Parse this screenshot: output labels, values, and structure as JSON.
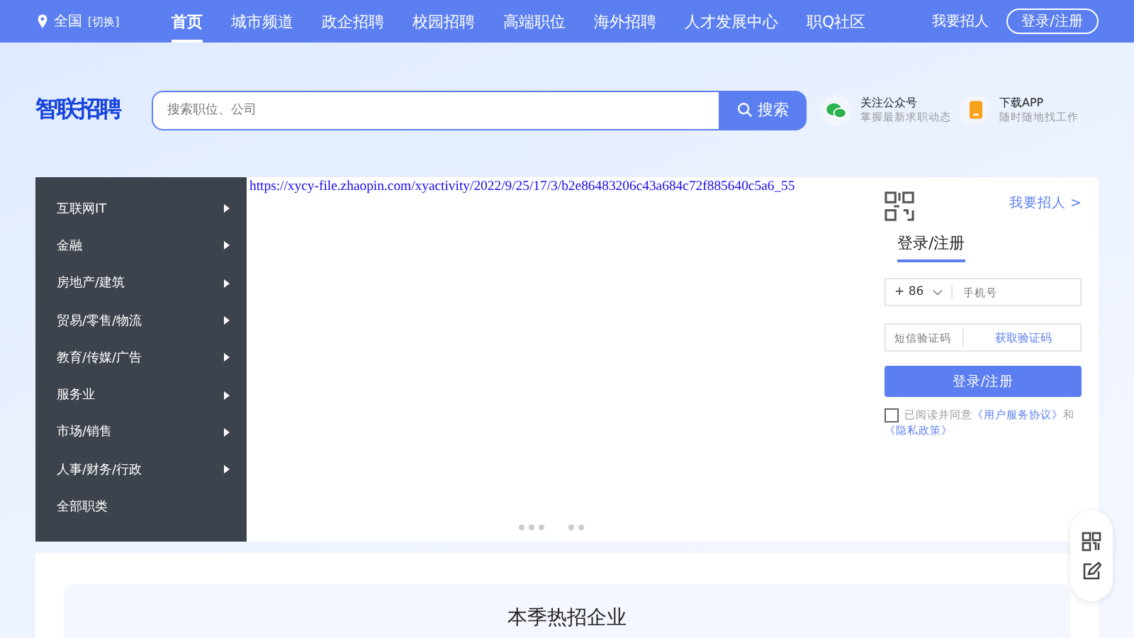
{
  "location": {
    "city": "全国",
    "switch": "[切换]"
  },
  "nav": [
    {
      "label": "首页",
      "selected": true
    },
    {
      "label": "城市频道",
      "selected": false
    },
    {
      "label": "政企招聘",
      "selected": false
    },
    {
      "label": "校园招聘",
      "selected": false
    },
    {
      "label": "高端职位",
      "selected": false
    },
    {
      "label": "海外招聘",
      "selected": false
    },
    {
      "label": "人才发展中心",
      "selected": false
    },
    {
      "label": "职Q社区",
      "selected": false
    }
  ],
  "employer_link": "我要招人",
  "login_button": "登录/注册",
  "logo": "智联招聘",
  "search": {
    "placeholder": "搜索职位、公司",
    "button": "搜索"
  },
  "promos": [
    {
      "title": "关注公众号",
      "subtitle": "掌握最新求职动态"
    },
    {
      "title": "下载APP",
      "subtitle": "随时随地找工作"
    }
  ],
  "categories": [
    {
      "label": "互联网IT",
      "has_submenu": true
    },
    {
      "label": "金融",
      "has_submenu": true
    },
    {
      "label": "房地产/建筑",
      "has_submenu": true
    },
    {
      "label": "贸易/零售/物流",
      "has_submenu": true
    },
    {
      "label": "教育/传媒/广告",
      "has_submenu": true
    },
    {
      "label": "服务业",
      "has_submenu": true
    },
    {
      "label": "市场/销售",
      "has_submenu": true
    },
    {
      "label": "人事/财务/行政",
      "has_submenu": true
    },
    {
      "label": "全部职类",
      "has_submenu": false
    }
  ],
  "banner": {
    "broken_image_url": "https://xycy-file.zhaopin.com/xyactivity/2022/9/25/17/3/b2e86483206c43a684c72f885640c5a6_55",
    "dot_groups": [
      {
        "dots": [
          {
            "selected": false
          },
          {
            "selected": false
          },
          {
            "selected": false
          }
        ]
      },
      {
        "dots": [
          {
            "selected": false
          },
          {
            "selected": false
          }
        ]
      }
    ]
  },
  "login": {
    "employer_link": "我要招人 >",
    "tab": "登录/注册",
    "country_code": "+ 86",
    "phone_placeholder": "手机号",
    "code_placeholder": "短信验证码",
    "get_code": "获取验证码",
    "submit": "登录/注册",
    "agree_checked": false,
    "agree_text": "已阅读并同意",
    "terms_link": "《用户服务协议》",
    "and": "和",
    "privacy_link": "《隐私政策》"
  },
  "section_title": "本季热招企业"
}
